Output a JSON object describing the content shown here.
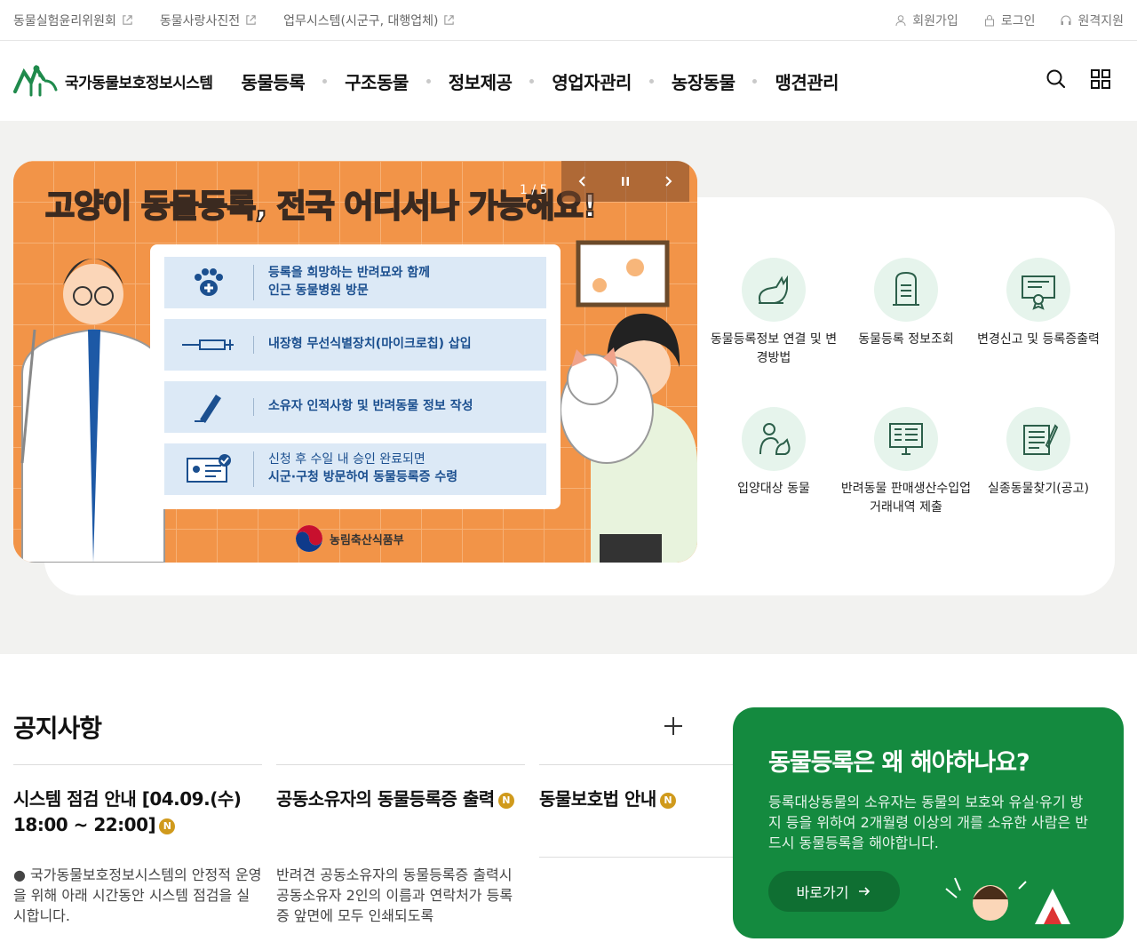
{
  "topbar": {
    "links": [
      {
        "label": "동물실험윤리위원회"
      },
      {
        "label": "동물사랑사진전"
      },
      {
        "label": "업무시스템(시군구, 대행업체)"
      }
    ],
    "util": {
      "join": "회원가입",
      "login": "로그인",
      "remote": "원격지원"
    }
  },
  "header": {
    "logo_text": "국가동물보호정보시스템",
    "nav": [
      "동물등록",
      "구조동물",
      "정보제공",
      "영업자관리",
      "농장동물",
      "맹견관리"
    ]
  },
  "banner": {
    "counter": "1 / 5",
    "title": "고양이 동물등록, 전국 어디서나 가능해요!",
    "steps": [
      {
        "line1": "등록을 희망하는 반려묘와 함께",
        "line2": "인근 동물병원 방문"
      },
      {
        "line1": "내장형 무선식별장치(마이크로칩) 삽입",
        "line2": ""
      },
      {
        "line1": "소유자 인적사항 및 반려동물 정보 작성",
        "line2": ""
      },
      {
        "line1": "신청 후 수일 내 승인 완료되면",
        "line2": "시군·구청 방문하여 동물등록증 수령"
      }
    ],
    "ministry": "농림축산식품부"
  },
  "quick": [
    {
      "label": "동물등록정보 연결 및 변경방법",
      "icon": "cat-icon"
    },
    {
      "label": "동물등록 정보조회",
      "icon": "document-icon"
    },
    {
      "label": "변경신고 및 등록증출력",
      "icon": "certificate-icon"
    },
    {
      "label": "입양대상 동물",
      "icon": "adoption-icon"
    },
    {
      "label": "반려동물 판매생산수입업 거래내역 제출",
      "icon": "monitor-icon"
    },
    {
      "label": "실종동물찾기(공고)",
      "icon": "notepad-icon"
    }
  ],
  "notice": {
    "title": "공지사항",
    "badge": "N",
    "items": [
      {
        "title": "시스템 점검 안내 [04.09.(수) 18:00 ~ 22:00]",
        "desc": "● 국가동물보호정보시스템의 안정적 운영을 위해 아래 시간동안 시스템 점검을 실시합니다."
      },
      {
        "title": "공동소유자의 동물등록증 출력",
        "desc": "반려견 공동소유자의 동물등록증 출력시 공동소유자 2인의 이름과 연락처가 등록증 앞면에 모두 인쇄되도록"
      },
      {
        "title": "동물보호법 안내",
        "desc": ""
      }
    ]
  },
  "promo": {
    "title": "동물등록은 왜 해야하나요?",
    "desc": "등록대상동물의 소유자는 동물의 보호와 유실·유기 방지 등을 위하여 2개월령 이상의 개를 소유한 사람은 반드시 동물등록을 해야합니다.",
    "button": "바로가기"
  },
  "colors": {
    "brand_green": "#148a3f",
    "banner_orange": "#f39a4d",
    "badge": "#d09a1c"
  }
}
